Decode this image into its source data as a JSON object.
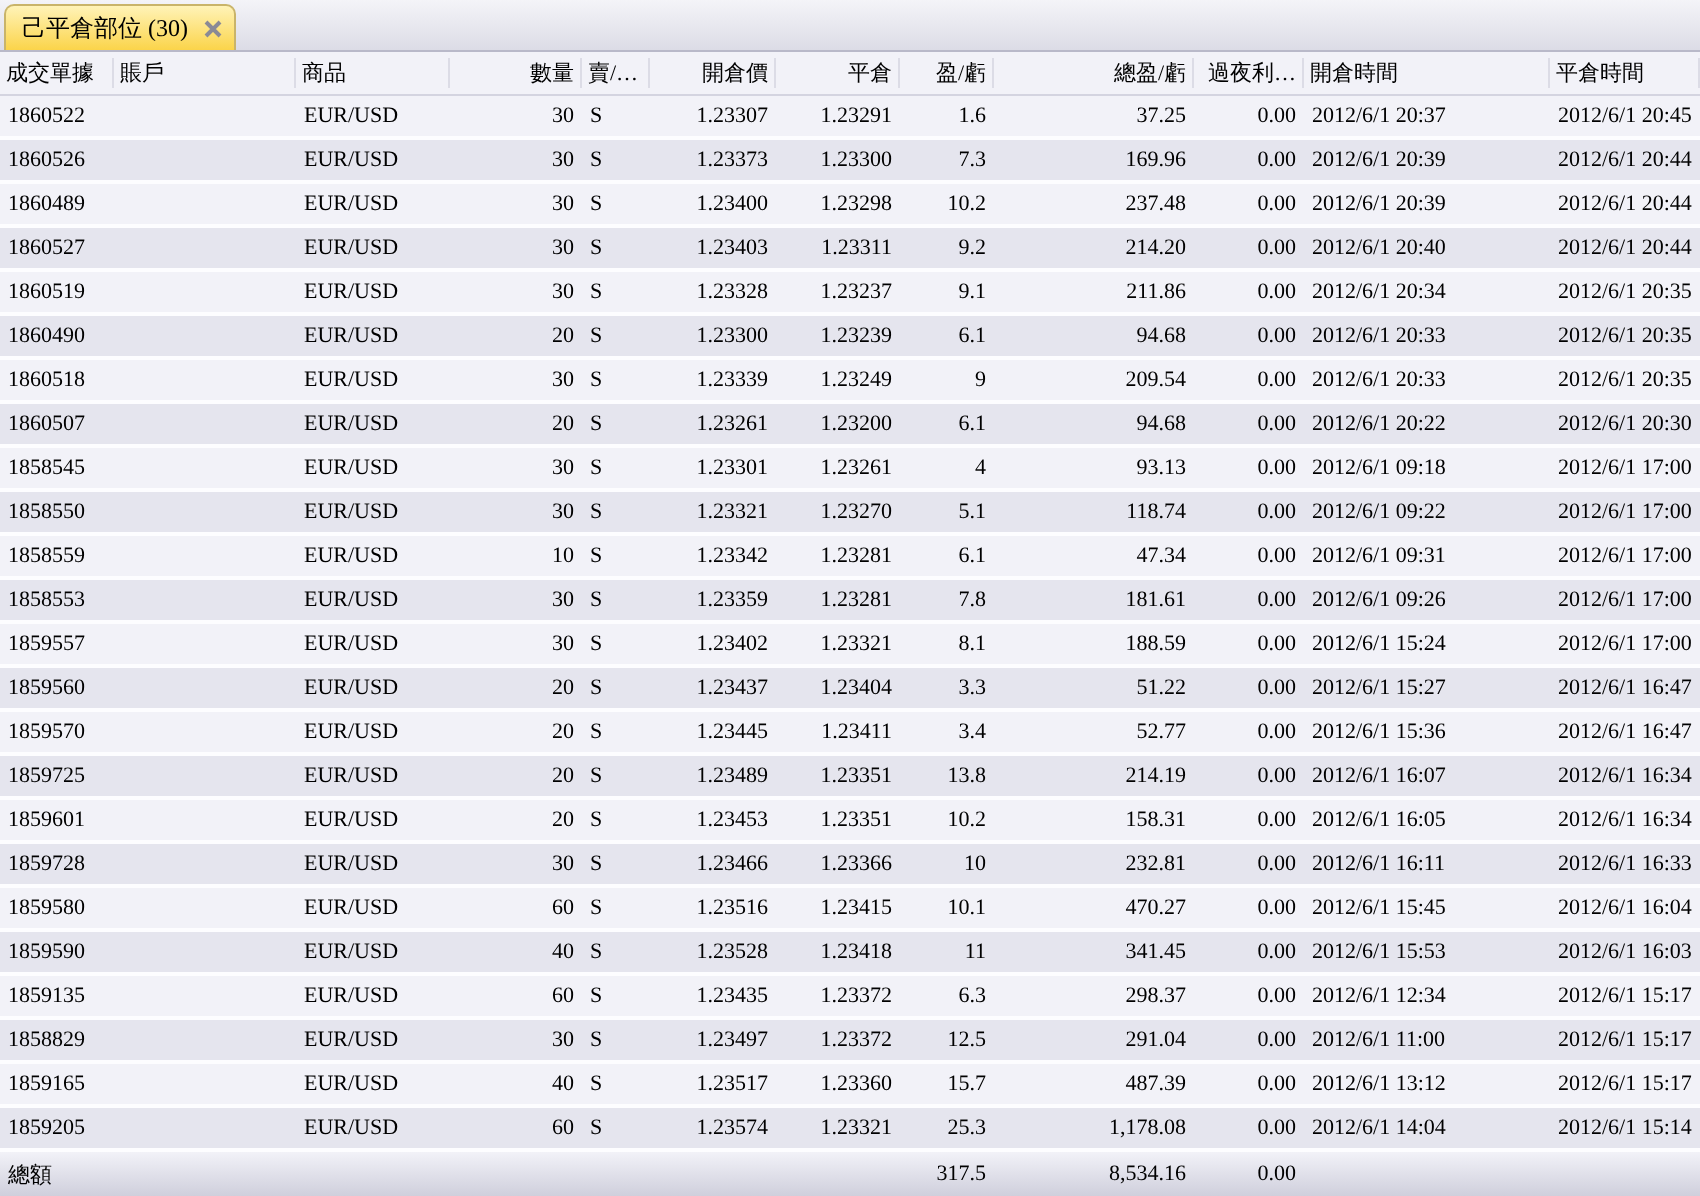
{
  "tab": {
    "label": "己平倉部位 (30)",
    "selected": true
  },
  "columns": [
    {
      "label": "成交單據"
    },
    {
      "label": "賬戶"
    },
    {
      "label": "商品"
    },
    {
      "label": "數量"
    },
    {
      "label": "賣/…"
    },
    {
      "label": "開倉價"
    },
    {
      "label": "平倉"
    },
    {
      "label": "盈/虧"
    },
    {
      "label": "總盈/虧"
    },
    {
      "label": "過夜利…"
    },
    {
      "label": "開倉時間"
    },
    {
      "label": "平倉時間"
    }
  ],
  "rows": [
    {
      "order": "1860522",
      "symbol": "EUR/USD",
      "quantity": "30",
      "side": "S",
      "open_price": "1.23307",
      "close_price": "1.23291",
      "pips": "1.6",
      "total_pl": "37.25",
      "overnight_interest": "0.00",
      "open_time": "2012/6/1 20:37",
      "close_time": "2012/6/1 20:45"
    },
    {
      "order": "1860526",
      "symbol": "EUR/USD",
      "quantity": "30",
      "side": "S",
      "open_price": "1.23373",
      "close_price": "1.23300",
      "pips": "7.3",
      "total_pl": "169.96",
      "overnight_interest": "0.00",
      "open_time": "2012/6/1 20:39",
      "close_time": "2012/6/1 20:44"
    },
    {
      "order": "1860489",
      "symbol": "EUR/USD",
      "quantity": "30",
      "side": "S",
      "open_price": "1.23400",
      "close_price": "1.23298",
      "pips": "10.2",
      "total_pl": "237.48",
      "overnight_interest": "0.00",
      "open_time": "2012/6/1 20:39",
      "close_time": "2012/6/1 20:44"
    },
    {
      "order": "1860527",
      "symbol": "EUR/USD",
      "quantity": "30",
      "side": "S",
      "open_price": "1.23403",
      "close_price": "1.23311",
      "pips": "9.2",
      "total_pl": "214.20",
      "overnight_interest": "0.00",
      "open_time": "2012/6/1 20:40",
      "close_time": "2012/6/1 20:44"
    },
    {
      "order": "1860519",
      "symbol": "EUR/USD",
      "quantity": "30",
      "side": "S",
      "open_price": "1.23328",
      "close_price": "1.23237",
      "pips": "9.1",
      "total_pl": "211.86",
      "overnight_interest": "0.00",
      "open_time": "2012/6/1 20:34",
      "close_time": "2012/6/1 20:35"
    },
    {
      "order": "1860490",
      "symbol": "EUR/USD",
      "quantity": "20",
      "side": "S",
      "open_price": "1.23300",
      "close_price": "1.23239",
      "pips": "6.1",
      "total_pl": "94.68",
      "overnight_interest": "0.00",
      "open_time": "2012/6/1 20:33",
      "close_time": "2012/6/1 20:35"
    },
    {
      "order": "1860518",
      "symbol": "EUR/USD",
      "quantity": "30",
      "side": "S",
      "open_price": "1.23339",
      "close_price": "1.23249",
      "pips": "9",
      "total_pl": "209.54",
      "overnight_interest": "0.00",
      "open_time": "2012/6/1 20:33",
      "close_time": "2012/6/1 20:35"
    },
    {
      "order": "1860507",
      "symbol": "EUR/USD",
      "quantity": "20",
      "side": "S",
      "open_price": "1.23261",
      "close_price": "1.23200",
      "pips": "6.1",
      "total_pl": "94.68",
      "overnight_interest": "0.00",
      "open_time": "2012/6/1 20:22",
      "close_time": "2012/6/1 20:30"
    },
    {
      "order": "1858545",
      "symbol": "EUR/USD",
      "quantity": "30",
      "side": "S",
      "open_price": "1.23301",
      "close_price": "1.23261",
      "pips": "4",
      "total_pl": "93.13",
      "overnight_interest": "0.00",
      "open_time": "2012/6/1 09:18",
      "close_time": "2012/6/1 17:00"
    },
    {
      "order": "1858550",
      "symbol": "EUR/USD",
      "quantity": "30",
      "side": "S",
      "open_price": "1.23321",
      "close_price": "1.23270",
      "pips": "5.1",
      "total_pl": "118.74",
      "overnight_interest": "0.00",
      "open_time": "2012/6/1 09:22",
      "close_time": "2012/6/1 17:00"
    },
    {
      "order": "1858559",
      "symbol": "EUR/USD",
      "quantity": "10",
      "side": "S",
      "open_price": "1.23342",
      "close_price": "1.23281",
      "pips": "6.1",
      "total_pl": "47.34",
      "overnight_interest": "0.00",
      "open_time": "2012/6/1 09:31",
      "close_time": "2012/6/1 17:00"
    },
    {
      "order": "1858553",
      "symbol": "EUR/USD",
      "quantity": "30",
      "side": "S",
      "open_price": "1.23359",
      "close_price": "1.23281",
      "pips": "7.8",
      "total_pl": "181.61",
      "overnight_interest": "0.00",
      "open_time": "2012/6/1 09:26",
      "close_time": "2012/6/1 17:00"
    },
    {
      "order": "1859557",
      "symbol": "EUR/USD",
      "quantity": "30",
      "side": "S",
      "open_price": "1.23402",
      "close_price": "1.23321",
      "pips": "8.1",
      "total_pl": "188.59",
      "overnight_interest": "0.00",
      "open_time": "2012/6/1 15:24",
      "close_time": "2012/6/1 17:00"
    },
    {
      "order": "1859560",
      "symbol": "EUR/USD",
      "quantity": "20",
      "side": "S",
      "open_price": "1.23437",
      "close_price": "1.23404",
      "pips": "3.3",
      "total_pl": "51.22",
      "overnight_interest": "0.00",
      "open_time": "2012/6/1 15:27",
      "close_time": "2012/6/1 16:47"
    },
    {
      "order": "1859570",
      "symbol": "EUR/USD",
      "quantity": "20",
      "side": "S",
      "open_price": "1.23445",
      "close_price": "1.23411",
      "pips": "3.4",
      "total_pl": "52.77",
      "overnight_interest": "0.00",
      "open_time": "2012/6/1 15:36",
      "close_time": "2012/6/1 16:47"
    },
    {
      "order": "1859725",
      "symbol": "EUR/USD",
      "quantity": "20",
      "side": "S",
      "open_price": "1.23489",
      "close_price": "1.23351",
      "pips": "13.8",
      "total_pl": "214.19",
      "overnight_interest": "0.00",
      "open_time": "2012/6/1 16:07",
      "close_time": "2012/6/1 16:34"
    },
    {
      "order": "1859601",
      "symbol": "EUR/USD",
      "quantity": "20",
      "side": "S",
      "open_price": "1.23453",
      "close_price": "1.23351",
      "pips": "10.2",
      "total_pl": "158.31",
      "overnight_interest": "0.00",
      "open_time": "2012/6/1 16:05",
      "close_time": "2012/6/1 16:34"
    },
    {
      "order": "1859728",
      "symbol": "EUR/USD",
      "quantity": "30",
      "side": "S",
      "open_price": "1.23466",
      "close_price": "1.23366",
      "pips": "10",
      "total_pl": "232.81",
      "overnight_interest": "0.00",
      "open_time": "2012/6/1 16:11",
      "close_time": "2012/6/1 16:33"
    },
    {
      "order": "1859580",
      "symbol": "EUR/USD",
      "quantity": "60",
      "side": "S",
      "open_price": "1.23516",
      "close_price": "1.23415",
      "pips": "10.1",
      "total_pl": "470.27",
      "overnight_interest": "0.00",
      "open_time": "2012/6/1 15:45",
      "close_time": "2012/6/1 16:04"
    },
    {
      "order": "1859590",
      "symbol": "EUR/USD",
      "quantity": "40",
      "side": "S",
      "open_price": "1.23528",
      "close_price": "1.23418",
      "pips": "11",
      "total_pl": "341.45",
      "overnight_interest": "0.00",
      "open_time": "2012/6/1 15:53",
      "close_time": "2012/6/1 16:03"
    },
    {
      "order": "1859135",
      "symbol": "EUR/USD",
      "quantity": "60",
      "side": "S",
      "open_price": "1.23435",
      "close_price": "1.23372",
      "pips": "6.3",
      "total_pl": "298.37",
      "overnight_interest": "0.00",
      "open_time": "2012/6/1 12:34",
      "close_time": "2012/6/1 15:17"
    },
    {
      "order": "1858829",
      "symbol": "EUR/USD",
      "quantity": "30",
      "side": "S",
      "open_price": "1.23497",
      "close_price": "1.23372",
      "pips": "12.5",
      "total_pl": "291.04",
      "overnight_interest": "0.00",
      "open_time": "2012/6/1 11:00",
      "close_time": "2012/6/1 15:17"
    },
    {
      "order": "1859165",
      "symbol": "EUR/USD",
      "quantity": "40",
      "side": "S",
      "open_price": "1.23517",
      "close_price": "1.23360",
      "pips": "15.7",
      "total_pl": "487.39",
      "overnight_interest": "0.00",
      "open_time": "2012/6/1 13:12",
      "close_time": "2012/6/1 15:17"
    },
    {
      "order": "1859205",
      "symbol": "EUR/USD",
      "quantity": "60",
      "side": "S",
      "open_price": "1.23574",
      "close_price": "1.23321",
      "pips": "25.3",
      "total_pl": "1,178.08",
      "overnight_interest": "0.00",
      "open_time": "2012/6/1 14:04",
      "close_time": "2012/6/1 15:14"
    }
  ],
  "totals": {
    "label": "總額",
    "pips": "317.5",
    "total_pl": "8,534.16",
    "overnight_interest": "0.00"
  }
}
